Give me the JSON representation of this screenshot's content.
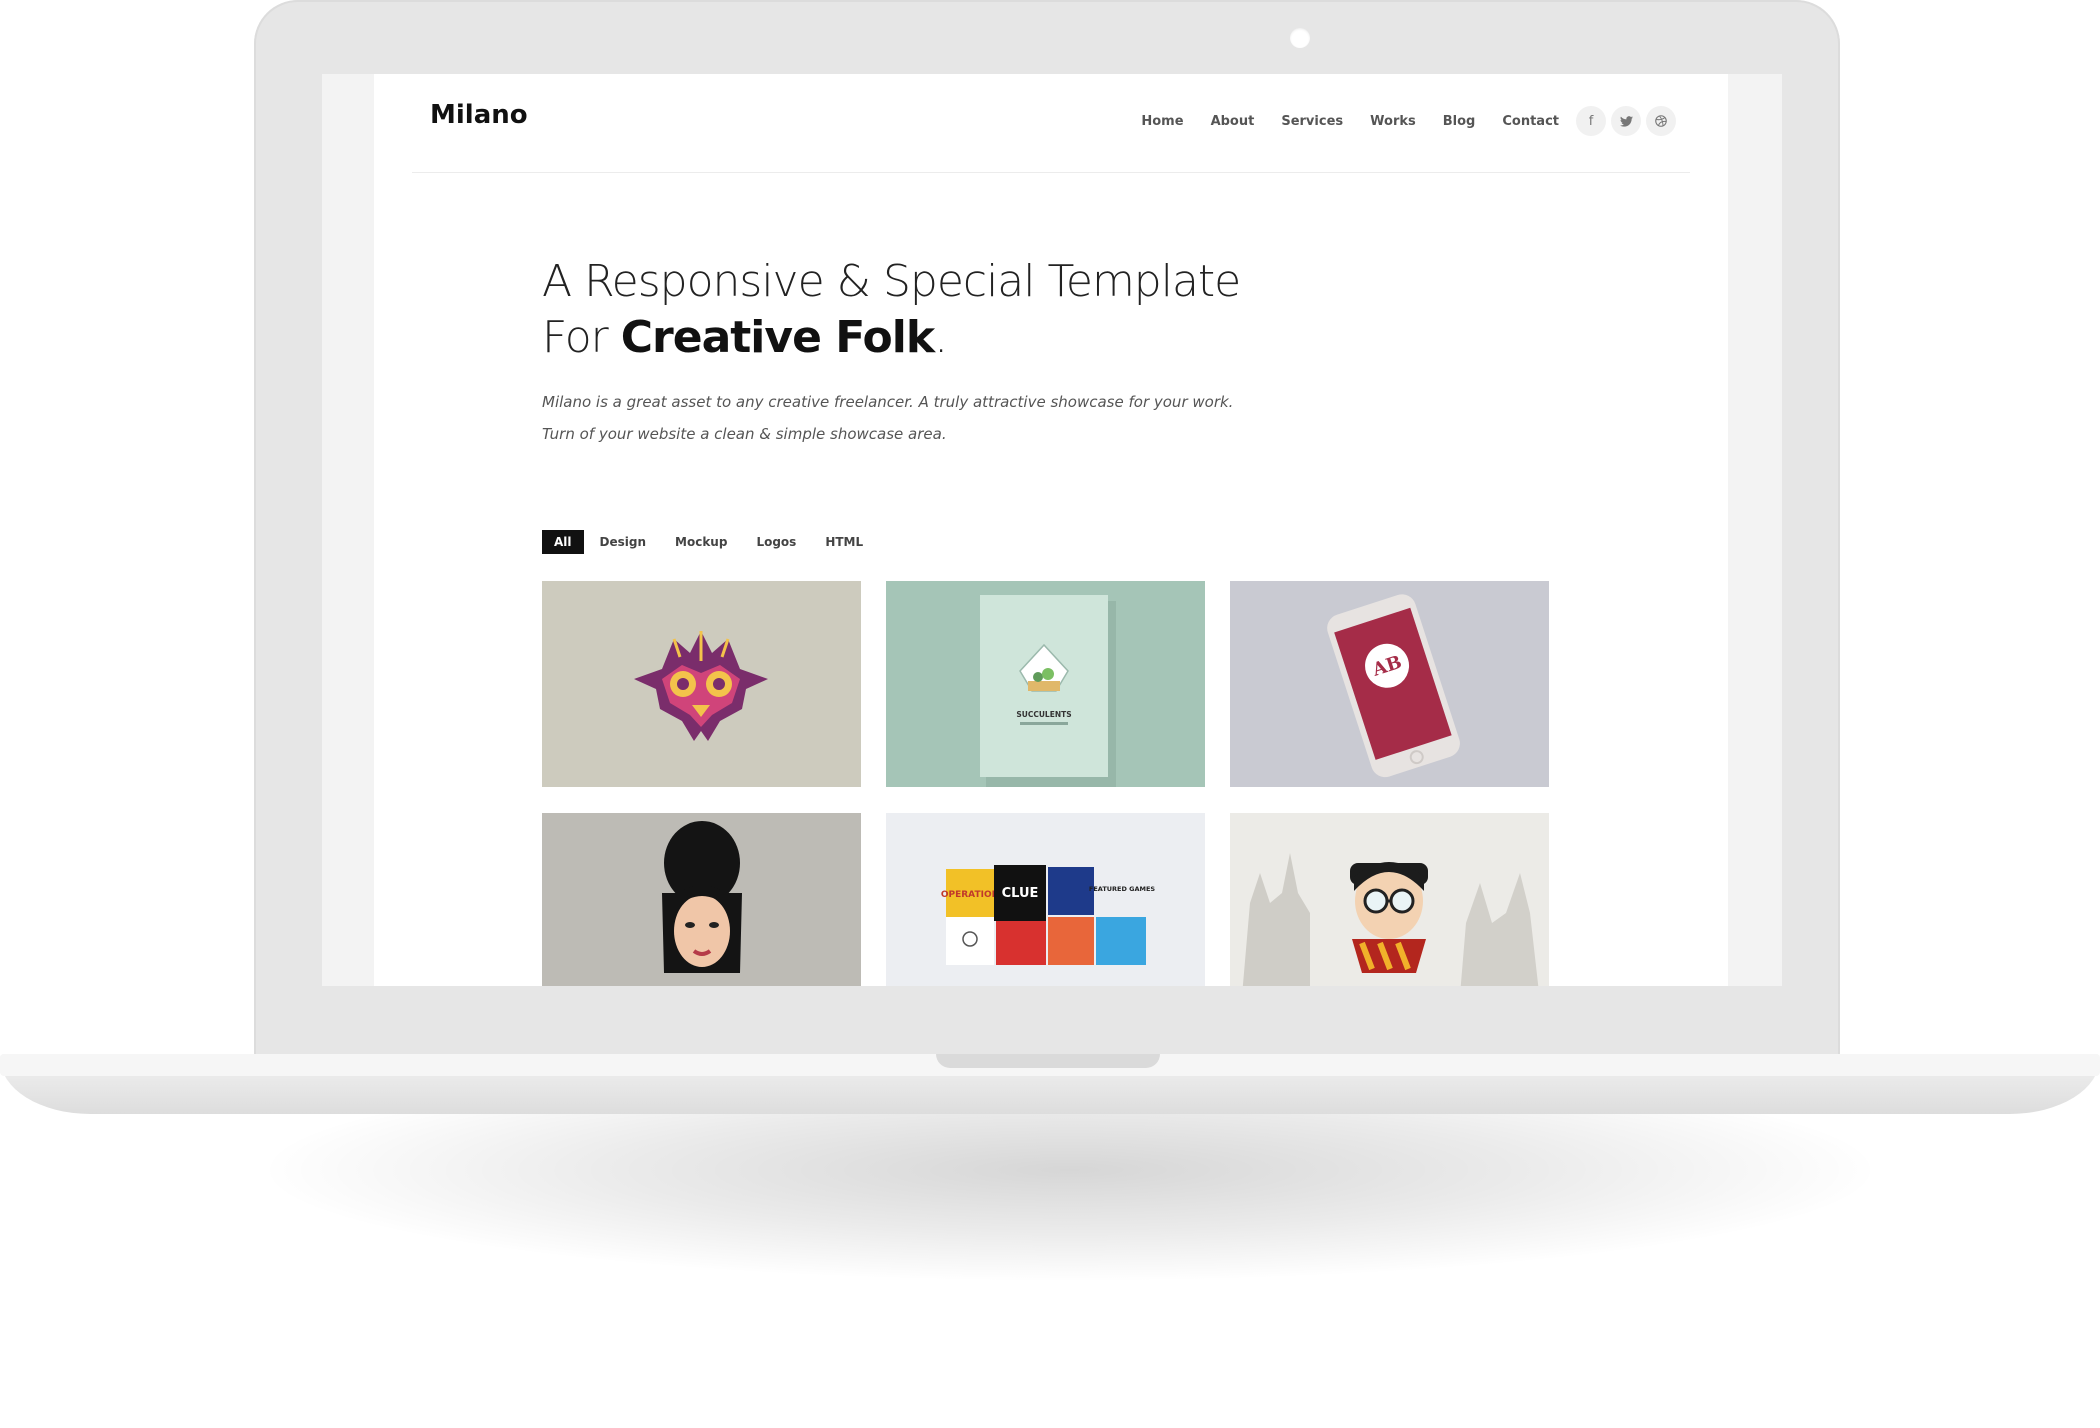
{
  "site": {
    "brand": "Milano"
  },
  "nav": {
    "items": [
      {
        "label": "Home"
      },
      {
        "label": "About"
      },
      {
        "label": "Services"
      },
      {
        "label": "Works"
      },
      {
        "label": "Blog"
      },
      {
        "label": "Contact"
      }
    ],
    "social": [
      {
        "icon": "facebook-icon",
        "glyph": "f"
      },
      {
        "icon": "twitter-icon"
      },
      {
        "icon": "dribbble-icon"
      }
    ]
  },
  "hero": {
    "line1": "A Responsive & Special Template",
    "line2_prefix": "For ",
    "line2_bold": "Creative Folk",
    "line2_suffix": ".",
    "subtitle_line1": "Milano is a great asset to any creative freelancer. A truly attractive showcase for your work.",
    "subtitle_line2": "Turn of your website a clean & simple showcase area."
  },
  "filters": {
    "items": [
      {
        "label": "All",
        "active": true
      },
      {
        "label": "Design"
      },
      {
        "label": "Mockup"
      },
      {
        "label": "Logos"
      },
      {
        "label": "HTML"
      }
    ]
  },
  "portfolio": {
    "items": [
      {
        "name": "mask-illustration",
        "background": "#cdcbbe"
      },
      {
        "name": "succulents-book",
        "background": "#a5c5b7",
        "book_title": "SUCCULENTS"
      },
      {
        "name": "phone-mockup",
        "background": "#c7c8d0",
        "logo_text": "AB"
      },
      {
        "name": "woman-portrait",
        "background": "#bdbbb5"
      },
      {
        "name": "featured-games",
        "background": "#eceef2",
        "labels": [
          "OPERATION",
          "CLUE",
          "FEATURED GAMES"
        ]
      },
      {
        "name": "wizard-boy",
        "background": "#ecebe7"
      }
    ]
  },
  "colors": {
    "text_dark": "#111111",
    "nav_text": "#555555",
    "accent_filter": "#111111",
    "laptop_body": "#e6e6e6"
  }
}
